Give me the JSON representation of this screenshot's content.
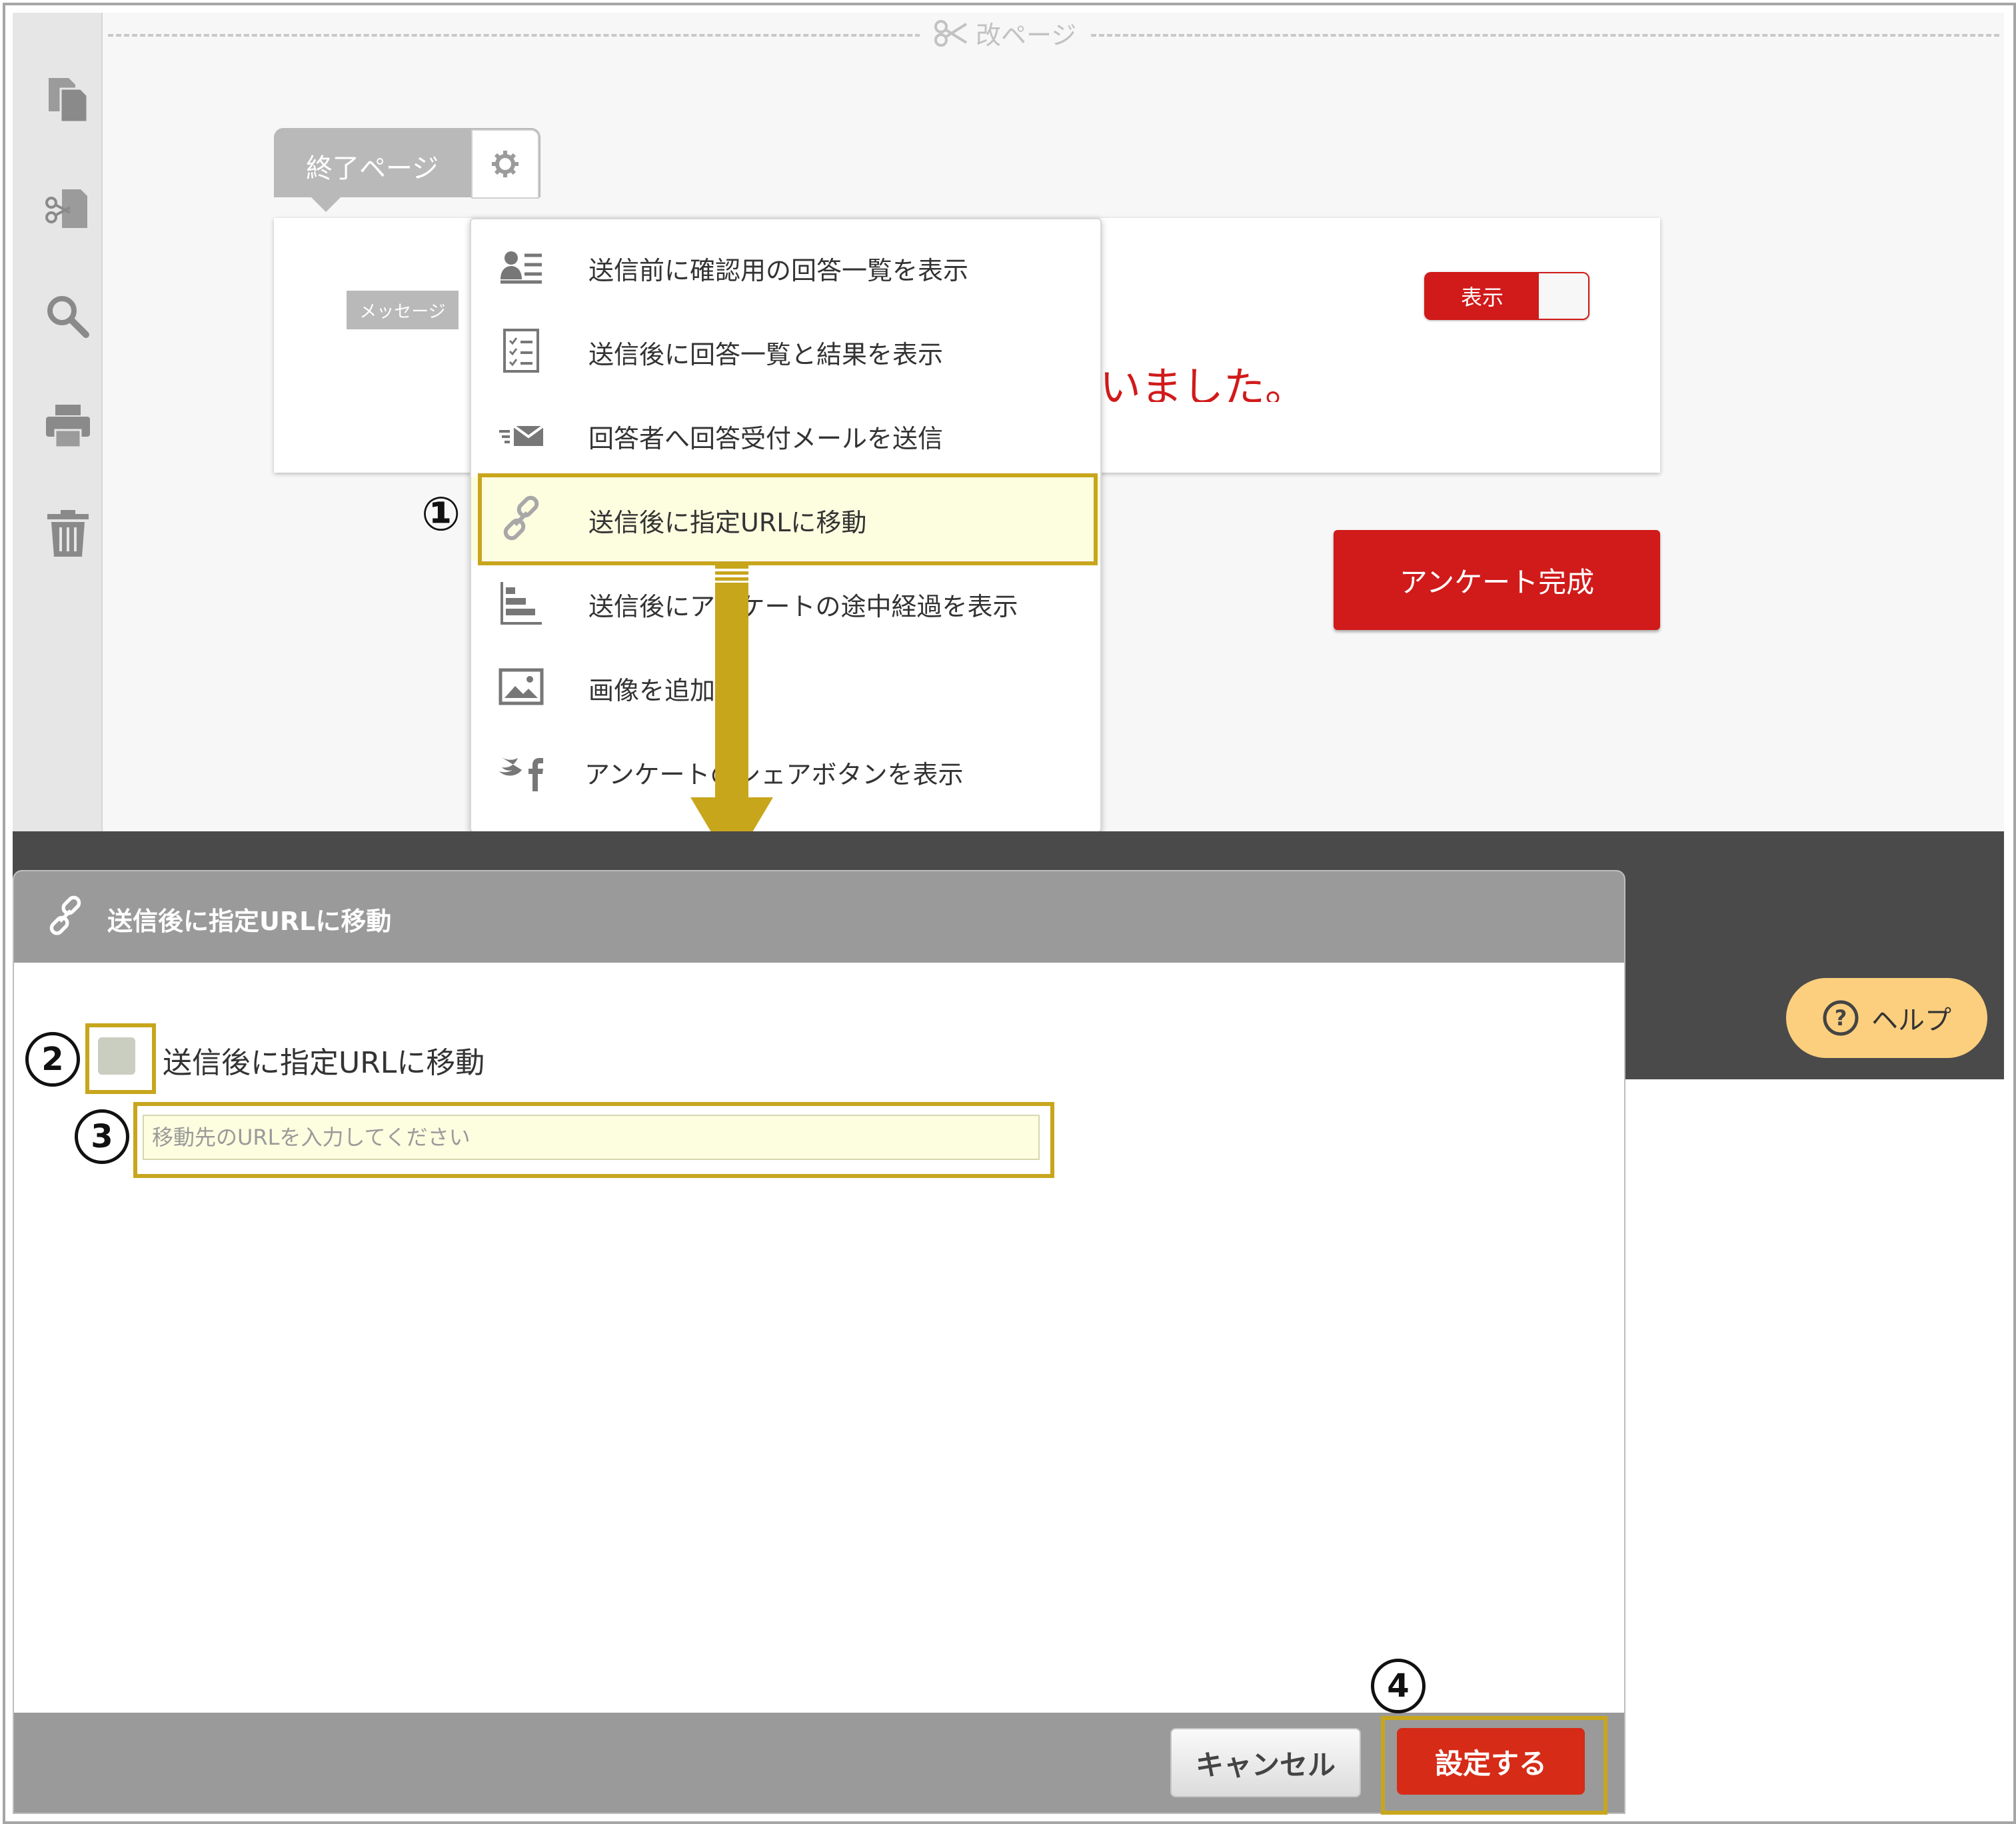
{
  "editor": {
    "page_break_label": "改ページ",
    "end_page_tab": "終了ページ",
    "message_badge": "メッセージ",
    "thanks_text_visible": "いました。",
    "toggle_label": "表示",
    "complete_button": "アンケート完成"
  },
  "sidebar_icons": [
    "copy-icon",
    "branch-icon",
    "search-icon",
    "print-icon",
    "trash-icon"
  ],
  "dropdown": {
    "items": [
      {
        "label": "送信前に確認用の回答一覧を表示",
        "icon": "user-list-icon"
      },
      {
        "label": "送信後に回答一覧と結果を表示",
        "icon": "checklist-icon"
      },
      {
        "label": "回答者へ回答受付メールを送信",
        "icon": "send-mail-icon"
      },
      {
        "label": "送信後に指定URLに移動",
        "icon": "link-icon"
      },
      {
        "label": "送信後にアンケートの途中経過を表示",
        "icon": "bar-chart-icon"
      },
      {
        "label": "画像を追加",
        "icon": "image-icon"
      },
      {
        "label": "アンケートのシェアボタンを表示",
        "icon": "social-share-icon"
      }
    ]
  },
  "steps": [
    "①",
    "2",
    "3",
    "4"
  ],
  "help_button": "ヘルプ",
  "modal": {
    "title": "送信後に指定URLに移動",
    "checkbox_label": "送信後に指定URLに移動",
    "url_input_placeholder": "移動先のURLを入力してください",
    "url_input_value": "",
    "cancel_button": "キャンセル",
    "set_button": "設定する"
  },
  "colors": {
    "accent_red": "#d11a1a",
    "highlight_gold": "#c8a61c",
    "help_orange": "#fbcf7e"
  }
}
